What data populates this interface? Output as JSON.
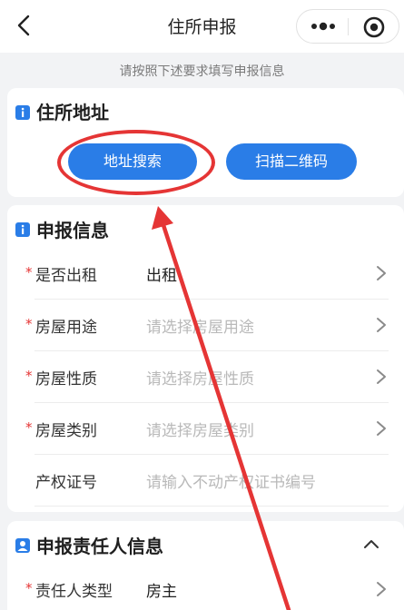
{
  "nav": {
    "title": "住所申报",
    "icons": {
      "back": "chevron-left-icon",
      "more": "more-dots-icon",
      "close": "circle-close-icon"
    }
  },
  "hint": "请按照下述要求填写申报信息",
  "address_section": {
    "title": "住所地址",
    "search_button": "地址搜索",
    "scan_button": "扫描二维码"
  },
  "declare_section": {
    "title": "申报信息",
    "rows": [
      {
        "required": "*",
        "label": "是否出租",
        "value": "出租",
        "placeholder": ""
      },
      {
        "required": "*",
        "label": "房屋用途",
        "value": "",
        "placeholder": "请选择房屋用途"
      },
      {
        "required": "*",
        "label": "房屋性质",
        "value": "",
        "placeholder": "请选择房屋性质"
      },
      {
        "required": "*",
        "label": "房屋类别",
        "value": "",
        "placeholder": "请选择房屋类别"
      },
      {
        "required": "",
        "label": "产权证号",
        "value": "",
        "placeholder": "请输入不动产权证书编号"
      }
    ]
  },
  "responsible_section": {
    "title": "申报责任人信息",
    "rows": [
      {
        "required": "*",
        "label": "责任人类型",
        "value": "房主"
      }
    ]
  },
  "colors": {
    "accent": "#2a7de7",
    "annotation": "#e53535",
    "background": "#f2f3f5"
  }
}
